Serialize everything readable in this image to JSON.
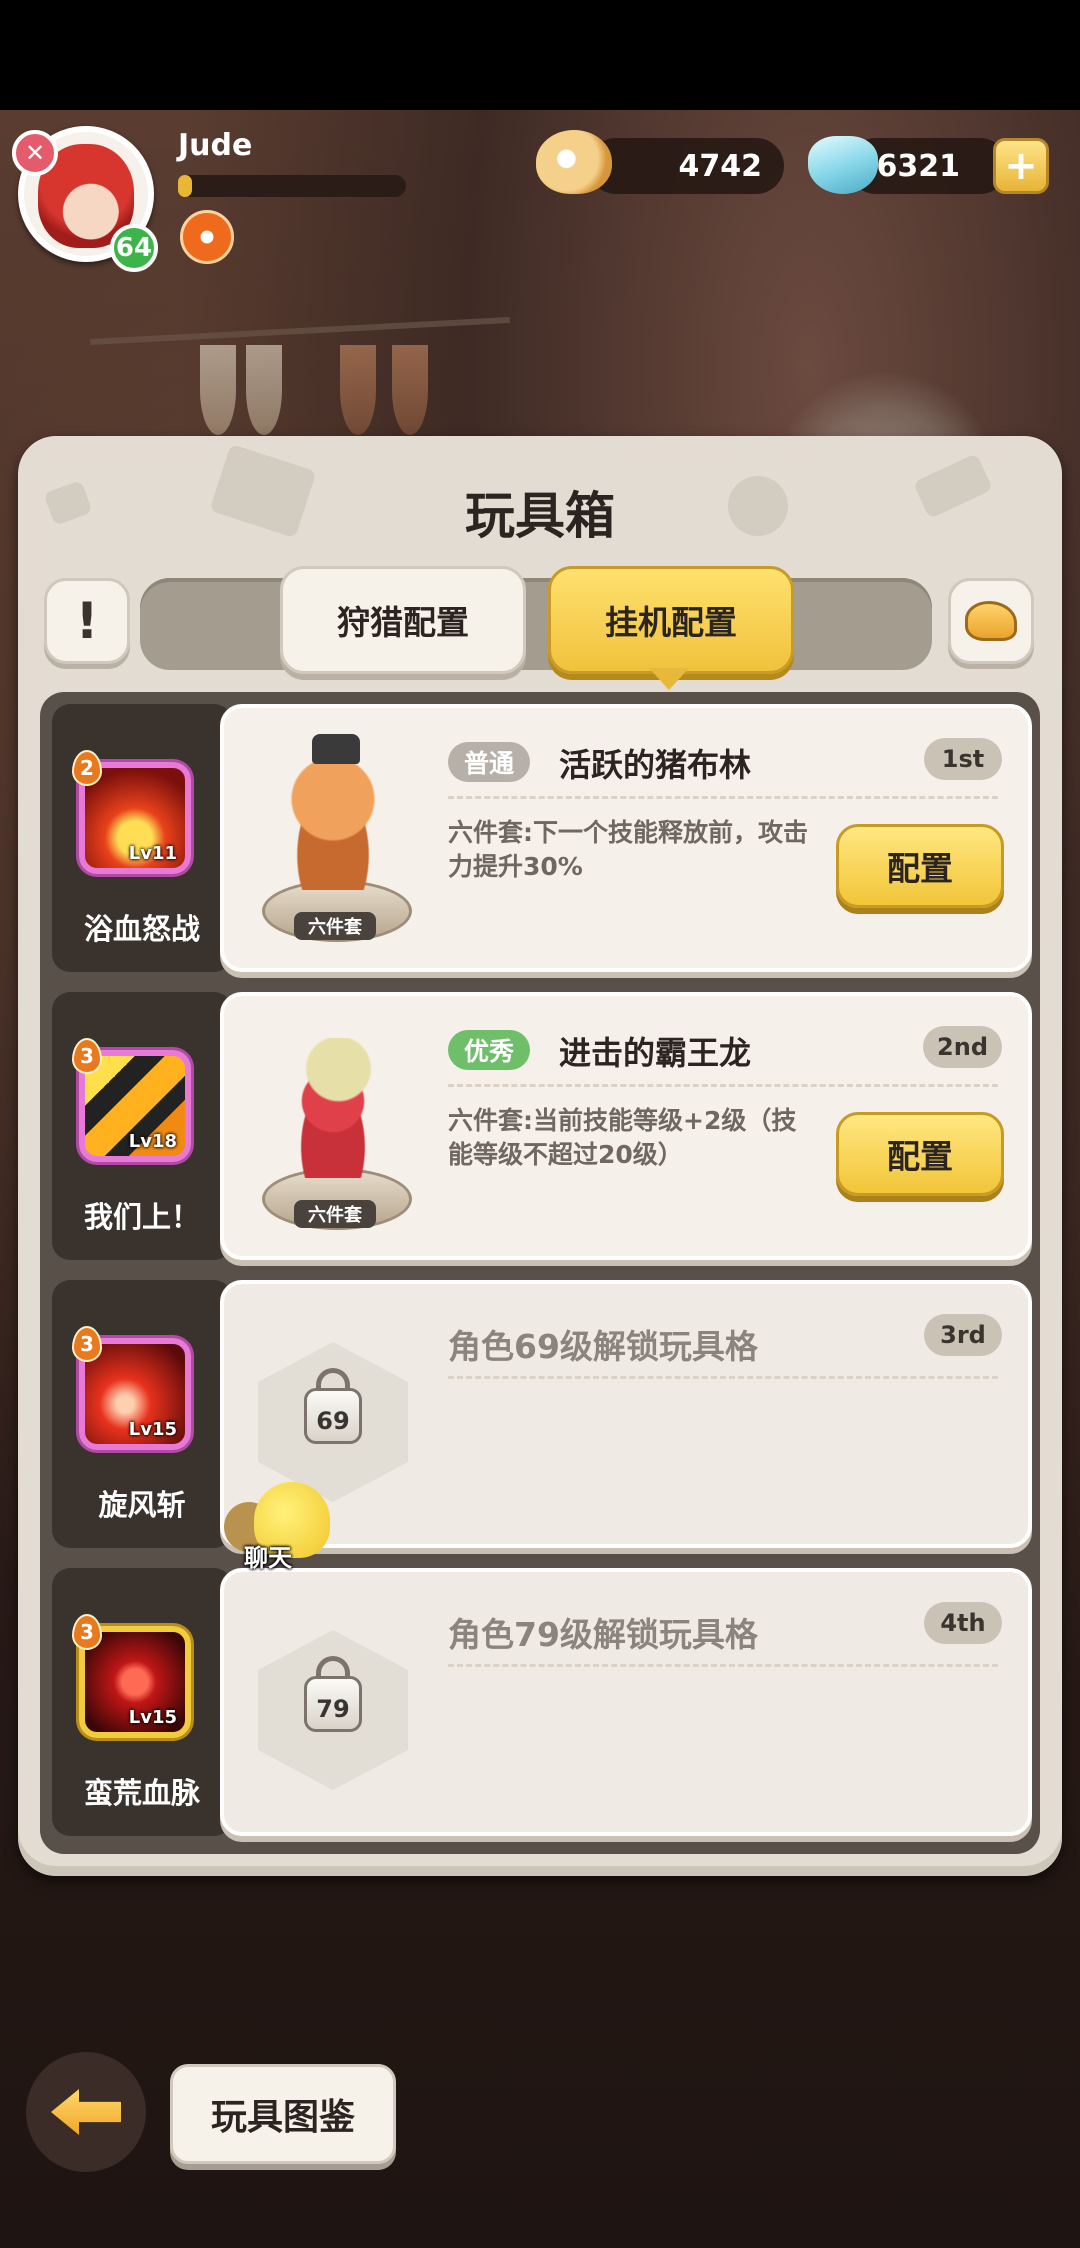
{
  "player": {
    "name": "Jude",
    "level": "64",
    "xp_fraction": 0.06
  },
  "currency": {
    "shells": "4742",
    "gems": "6321",
    "add": "+"
  },
  "panel": {
    "title": "玩具箱",
    "info": "!",
    "tabs": [
      {
        "label": "狩猎配置",
        "selected": false
      },
      {
        "label": "挂机配置",
        "selected": true
      }
    ]
  },
  "rows": [
    {
      "skill": {
        "name": "浴血怒战",
        "level": "Lv11",
        "count": "2",
        "icon": "blood-rage-skill-icon"
      },
      "rarity": "普通",
      "rarity_color": "#b6b0a8",
      "toy_name": "活跃的猪布林",
      "rank": "1st",
      "desc": "六件套:下一个技能释放前，攻击力提升30%",
      "set_label": "六件套",
      "button": "配置"
    },
    {
      "skill": {
        "name": "我们上！",
        "level": "Lv18",
        "count": "3",
        "icon": "charge-skill-icon"
      },
      "rarity": "优秀",
      "rarity_color": "#6fbf6a",
      "toy_name": "进击的霸王龙",
      "rank": "2nd",
      "desc": "六件套:当前技能等级+2级（技能等级不超过20级）",
      "set_label": "六件套",
      "button": "配置"
    },
    {
      "skill": {
        "name": "旋风斩",
        "level": "Lv15",
        "count": "3",
        "icon": "whirlwind-skill-icon"
      },
      "locked_text": "角色69级解锁玩具格",
      "lock_level": "69",
      "rank": "3rd"
    },
    {
      "skill": {
        "name": "蛮荒血脉",
        "level": "Lv15",
        "count": "3",
        "icon": "blood-drop-skill-icon"
      },
      "locked_text": "角色79级解锁玩具格",
      "lock_level": "79",
      "rank": "4th"
    }
  ],
  "chat": {
    "label": "聊天"
  },
  "bottom": {
    "codex": "玩具图鉴"
  }
}
